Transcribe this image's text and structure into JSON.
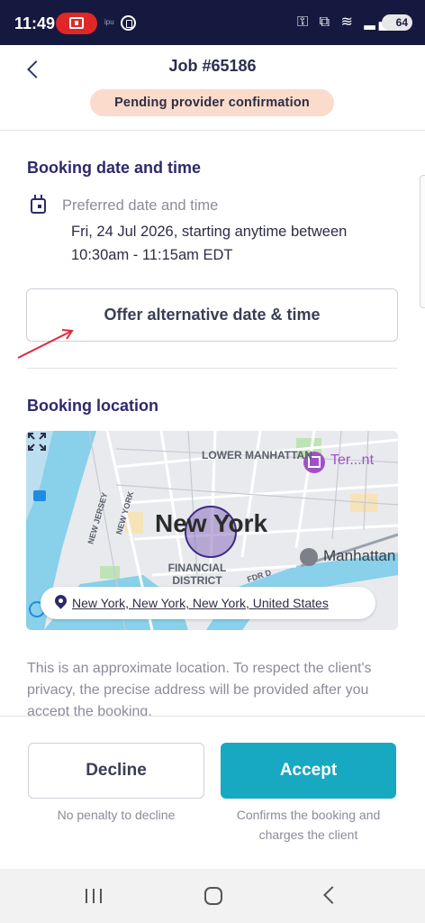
{
  "status_bar": {
    "time": "11:49",
    "small_text": "ipu",
    "icons_text": "⚿ ⧉ ≋ ▂▄▆",
    "battery": "64"
  },
  "header": {
    "title": "Job #65186",
    "status_badge": "Pending provider confirmation",
    "badge_color": "#fbdbcb"
  },
  "booking_time": {
    "section_title": "Booking date and time",
    "preferred_label": "Preferred date and time",
    "preferred_value": "Fri, 24 Jul 2026, starting anytime between 10:30am - 11:15am EDT",
    "offer_button": "Offer alternative date & time"
  },
  "booking_location": {
    "section_title": "Booking location",
    "map": {
      "labels": {
        "lower_manhattan": "LOWER MANHATTAN",
        "city": "New York",
        "financial_district": "FINANCIAL DISTRICT",
        "manhattan": "Manhattan",
        "poi": "Ter...nt",
        "new_jersey": "NEW JERSEY",
        "new_york_road": "NEW YORK",
        "road_fdr": "FDR D"
      }
    },
    "address": "New York, New York, New York, United States",
    "privacy_note": "This is an approximate location. To respect the client's privacy, the precise address will be provided after you accept the booking."
  },
  "actions": {
    "decline_label": "Decline",
    "decline_hint": "No penalty to decline",
    "accept_label": "Accept",
    "accept_hint": "Confirms the booking and charges the client",
    "accept_color": "#17a9c1"
  }
}
